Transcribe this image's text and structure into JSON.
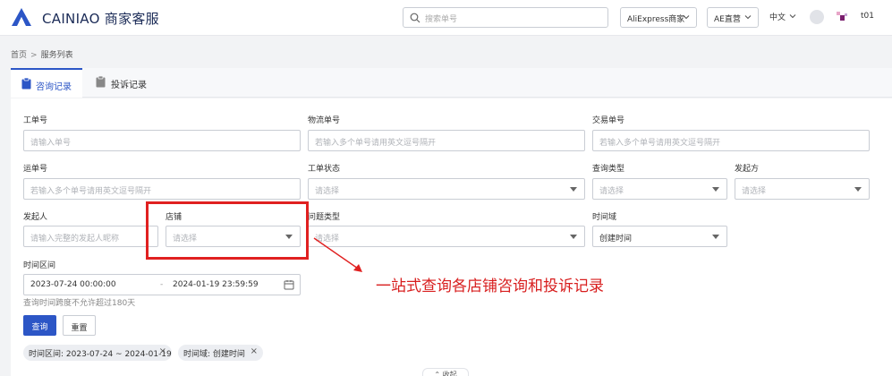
{
  "header": {
    "brand": "CAINIAO 商家客服",
    "search_placeholder": "搜索单号",
    "platform_dropdown": "AliExpress商家",
    "mode_dropdown": "AE直营",
    "language": "中文",
    "username": "t01"
  },
  "breadcrumb": {
    "home": "首页",
    "current": "服务列表"
  },
  "tabs": [
    {
      "label": "咨询记录",
      "icon": "clipboard-icon",
      "active": true
    },
    {
      "label": "投诉记录",
      "icon": "document-icon",
      "active": false
    }
  ],
  "form": {
    "ticket_no": {
      "label": "工单号",
      "placeholder": "请输入单号"
    },
    "logistics_no": {
      "label": "物流单号",
      "placeholder": "若输入多个单号请用英文逗号隔开"
    },
    "trade_no": {
      "label": "交易单号",
      "placeholder": "若输入多个单号请用英文逗号隔开"
    },
    "waybill_no": {
      "label": "运单号",
      "placeholder": "若输入多个单号请用英文逗号隔开"
    },
    "ticket_status": {
      "label": "工单状态",
      "placeholder": "请选择"
    },
    "query_type": {
      "label": "查询类型",
      "placeholder": "请选择"
    },
    "initiator_side": {
      "label": "发起方",
      "placeholder": "请选择"
    },
    "initiator": {
      "label": "发起人",
      "placeholder": "请输入完整的发起人昵称"
    },
    "store": {
      "label": "店铺",
      "placeholder": "请选择"
    },
    "issue_type": {
      "label": "问题类型",
      "placeholder": "请选择"
    },
    "time_field": {
      "label": "时间域",
      "value": "创建时间"
    },
    "time_range": {
      "label": "时间区间",
      "start": "2023-07-24 00:00:00",
      "end": "2024-01-19 23:59:59",
      "separator": "-"
    },
    "time_hint": "查询时间跨度不允许超过180天"
  },
  "buttons": {
    "query": "查询",
    "reset": "重置",
    "collapse": "收起"
  },
  "filters": [
    {
      "label": "时间区间: 2023-07-24 ~ 2024-01-19"
    },
    {
      "label": "时间域: 创建时间"
    }
  ],
  "annotation": {
    "text": "一站式查询各店铺咨询和投诉记录",
    "color": "#e02020"
  },
  "colors": {
    "primary": "#2c56c6",
    "annotation": "#d81e1e"
  }
}
